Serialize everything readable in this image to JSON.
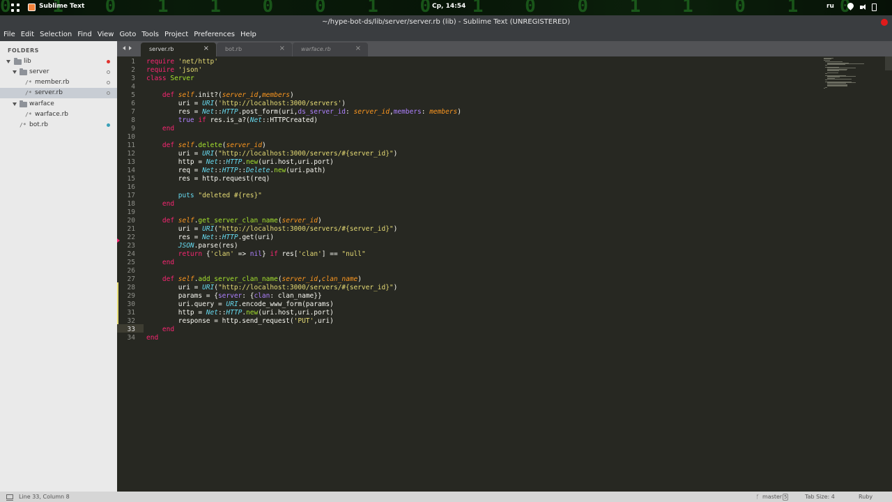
{
  "topbar": {
    "app_name": "Sublime Text",
    "clock": "Ср, 14:54",
    "language": "ru",
    "background_glyphs": "0 1 0 1 1 0 0 1 0 1 0 0 1 1 0 1 0 0 1 0 1 1 0 1 0 1 0 0 1"
  },
  "window": {
    "title": "~/hype-bot-ds/lib/server/server.rb (lib) - Sublime Text (UNREGISTERED)"
  },
  "menu": [
    "File",
    "Edit",
    "Selection",
    "Find",
    "View",
    "Goto",
    "Tools",
    "Project",
    "Preferences",
    "Help"
  ],
  "sidebar": {
    "title": "FOLDERS",
    "items": [
      {
        "label": "lib",
        "kind": "folder"
      },
      {
        "label": "server",
        "kind": "folder"
      },
      {
        "label": "member.rb",
        "kind": "file"
      },
      {
        "label": "server.rb",
        "kind": "file"
      },
      {
        "label": "warface",
        "kind": "folder"
      },
      {
        "label": "warface.rb",
        "kind": "file"
      },
      {
        "label": "bot.rb",
        "kind": "file"
      }
    ]
  },
  "tabs": [
    {
      "label": "server.rb",
      "close": "×"
    },
    {
      "label": "bot.rb",
      "close": "×"
    },
    {
      "label": "warface.rb",
      "close": "×"
    }
  ],
  "editor": {
    "line_numbers": [
      "1",
      "2",
      "3",
      "4",
      "5",
      "6",
      "7",
      "8",
      "9",
      "10",
      "11",
      "12",
      "13",
      "14",
      "15",
      "16",
      "17",
      "18",
      "19",
      "20",
      "21",
      "22",
      "23",
      "24",
      "25",
      "26",
      "27",
      "28",
      "29",
      "30",
      "31",
      "32",
      "33",
      "34"
    ],
    "lines": [
      "require 'net/http'",
      "require 'json'",
      "class Server",
      "",
      "    def self.init?(server_id,members)",
      "        uri = URI('http://localhost:3000/servers')",
      "        res = Net::HTTP.post_form(uri,ds_server_id: server_id,members: members)",
      "        true if res.is_a?(Net::HTTPCreated)",
      "    end",
      "",
      "    def self.delete(server_id)",
      "        uri = URI(\"http://localhost:3000/servers/#{server_id}\")",
      "        http = Net::HTTP.new(uri.host,uri.port)",
      "        req = Net::HTTP::Delete.new(uri.path)",
      "        res = http.request(req)",
      "",
      "        puts \"deleted #{res}\"",
      "    end",
      "",
      "    def self.get_server_clan_name(server_id)",
      "        uri = URI(\"http://localhost:3000/servers/#{server_id}\")",
      "        res = Net::HTTP.get(uri)",
      "        JSON.parse(res)",
      "        return {'clan' => nil} if res['clan'] == \"null\"",
      "    end",
      "",
      "    def self.add_server_clan_name(server_id,clan_name)",
      "        uri = URI(\"http://localhost:3000/servers/#{server_id}\")",
      "        params = {server: {clan: clan_name}}",
      "        uri.query = URI.encode_www_form(params)",
      "        http = Net::HTTP.new(uri.host,uri.port)",
      "        response = http.send_request('PUT',uri)",
      "    end",
      "end"
    ],
    "current_line": 33
  },
  "status": {
    "position": "Line 33, Column 8",
    "branch": "master",
    "branch_count": "5",
    "tab_size": "Tab Size: 4",
    "syntax": "Ruby"
  },
  "colors": {
    "editor_bg": "#272822",
    "keyword": "#f92672",
    "string": "#e6db74",
    "class_name": "#a6e22e",
    "builtin": "#66d9ef",
    "param": "#fd971f",
    "constant": "#ae81ff"
  }
}
